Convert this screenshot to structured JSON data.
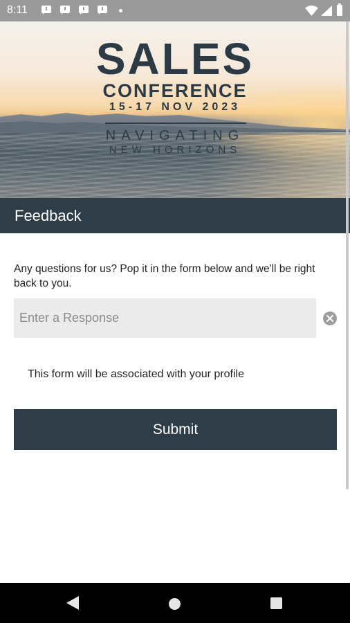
{
  "status_bar": {
    "time": "8:11",
    "icons": [
      "message-notification-icon",
      "message-notification-icon",
      "message-notification-icon",
      "message-notification-icon",
      "dot-icon",
      "wifi-icon",
      "signal-icon",
      "battery-icon"
    ]
  },
  "banner": {
    "title_line1": "SALES",
    "title_line2": "CONFERENCE",
    "date": "15-17 NOV 2023",
    "tagline_line1": "NAVIGATING",
    "tagline_line2": "NEW HORIZONS"
  },
  "header": {
    "title": "Feedback"
  },
  "form": {
    "prompt": "Any questions for us? Pop it in the form below and we'll be right back to you.",
    "response_placeholder": "Enter a Response",
    "response_value": "",
    "clear_icon": "clear-circle-icon",
    "profile_note": "This form will be associated with your profile",
    "submit_label": "Submit"
  },
  "nav_bar": {
    "icons": [
      "back-icon",
      "home-icon",
      "recents-icon"
    ]
  },
  "colors": {
    "header_bg": "#2e3d48",
    "button_bg": "#2e3d48",
    "input_bg": "#ebebeb",
    "status_bar_bg": "#9a9a9a",
    "nav_bar_bg": "#000000",
    "banner_text": "#2c3a45"
  }
}
